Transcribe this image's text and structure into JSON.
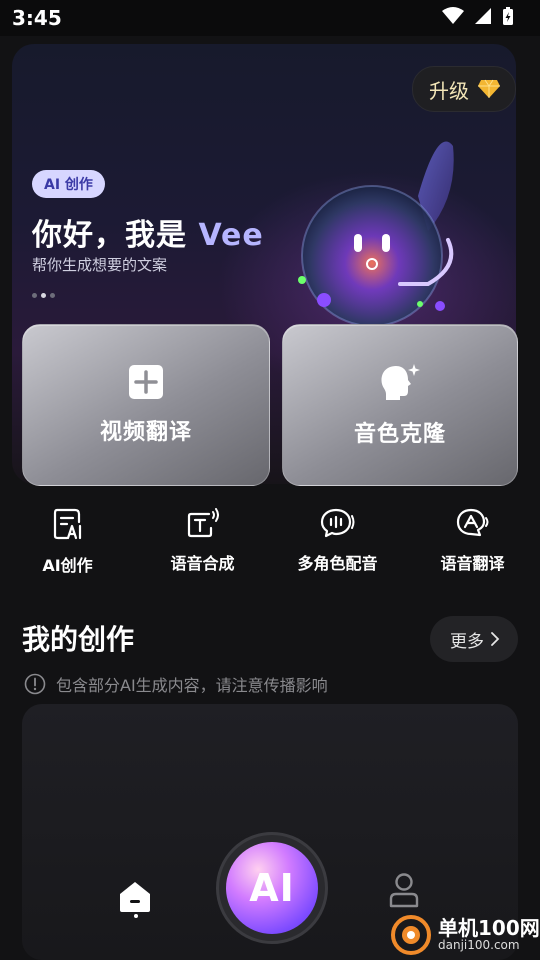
{
  "status_bar": {
    "time": "3:45"
  },
  "hero": {
    "upgrade_label": "升级",
    "badge": "AI 创作",
    "greeting_prefix": "你好，我是 ",
    "greeting_name": "Vee",
    "subtitle": "帮你生成想要的文案",
    "carousel_pages": 3,
    "carousel_active": 2
  },
  "feature_cards": [
    {
      "label": "视频翻译",
      "icon": "plus-square-icon"
    },
    {
      "label": "音色克隆",
      "icon": "voice-clone-icon"
    }
  ],
  "tools": [
    {
      "label": "AI创作",
      "icon": "ai-document-icon"
    },
    {
      "label": "语音合成",
      "icon": "text-to-speech-icon"
    },
    {
      "label": "多角色配音",
      "icon": "multi-voice-icon"
    },
    {
      "label": "语音翻译",
      "icon": "voice-translate-icon"
    }
  ],
  "my_creations": {
    "title": "我的创作",
    "more_label": "更多",
    "notice": "包含部分AI生成内容，请注意传播影响"
  },
  "bottom_nav": {
    "home_icon": "home-icon",
    "ai_label": "AI",
    "profile_icon": "person-icon"
  },
  "watermark": {
    "line1": "单机100网",
    "line2": "danji100.com"
  },
  "colors": {
    "accent": "#b6b5ff",
    "background": "#121214",
    "ai_button": "#d27cff"
  }
}
